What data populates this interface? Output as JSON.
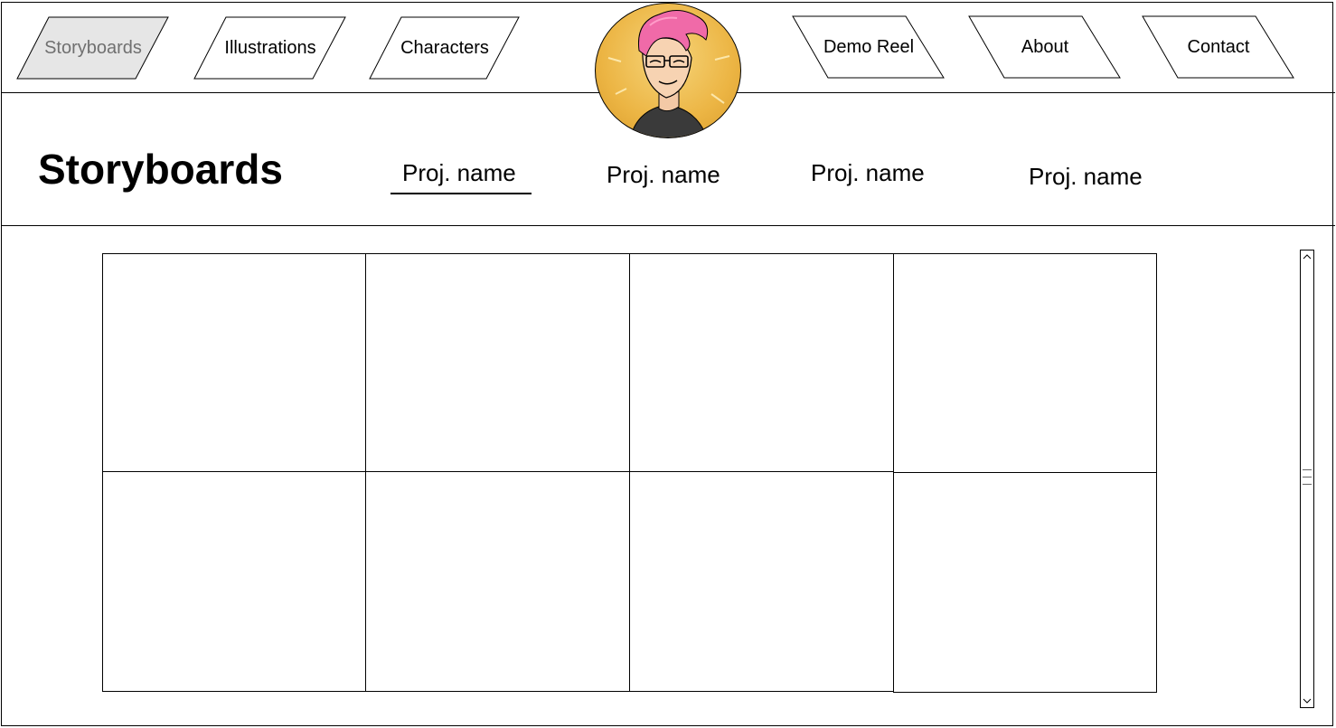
{
  "nav": {
    "items": [
      {
        "label": "Storyboards",
        "active": true
      },
      {
        "label": "Illustrations",
        "active": false
      },
      {
        "label": "Characters",
        "active": false
      },
      {
        "label": "Demo Reel",
        "active": false
      },
      {
        "label": "About",
        "active": false
      },
      {
        "label": "Contact",
        "active": false
      }
    ],
    "avatar_icon": "avatar-portrait-icon"
  },
  "section": {
    "title": "Storyboards",
    "project_tabs": [
      {
        "label": "Proj. name",
        "selected": true
      },
      {
        "label": "Proj. name",
        "selected": false
      },
      {
        "label": "Proj. name",
        "selected": false
      },
      {
        "label": "Proj. name",
        "selected": false
      }
    ]
  },
  "gallery": {
    "rows": 2,
    "columns": 4,
    "thumbnails": [
      "",
      "",
      "",
      "",
      "",
      "",
      "",
      ""
    ]
  },
  "scrollbar": {
    "up_icon": "chevron-up-icon",
    "down_icon": "chevron-down-icon",
    "grip_icon": "grip-lines-icon"
  },
  "colors": {
    "active_nav_fill": "#e6e6e6",
    "active_nav_text": "#707070",
    "avatar_bg": "#ecb544",
    "avatar_hair": "#f06aa8"
  }
}
